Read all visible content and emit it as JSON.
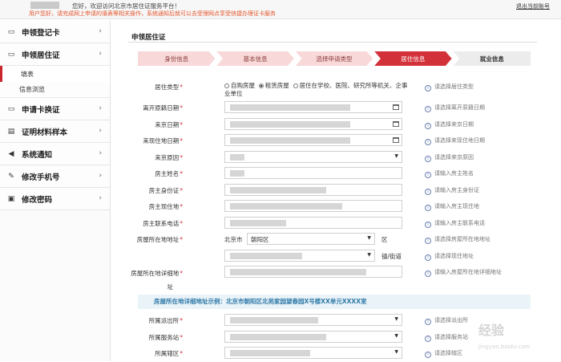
{
  "topbar": {
    "greeting": "您好，欢迎访问北京市居住证服务平台！",
    "notice": "用户您好，请完成网上申请的填表等相关操作，系统通知后就可以去受理网点享受快捷办理证卡服务",
    "logout": "退出当前账号"
  },
  "sidebar": {
    "items": [
      {
        "label": "申领登记卡",
        "icon": "id-card-icon"
      },
      {
        "label": "申领居住证",
        "icon": "id-card-icon"
      },
      {
        "label": "申请卡换证",
        "icon": "id-card-icon"
      },
      {
        "label": "证明材料样本",
        "icon": "document-icon"
      },
      {
        "label": "系统通知",
        "icon": "speaker-icon"
      },
      {
        "label": "修改手机号",
        "icon": "edit-icon"
      },
      {
        "label": "修改密码",
        "icon": "lock-icon"
      }
    ],
    "sub_fill": "填表",
    "sub_info": "信息浏览"
  },
  "main": {
    "title": "申领居住证",
    "steps": [
      "身份信息",
      "基本信息",
      "选择申请类型",
      "居住信息",
      "就业信息"
    ],
    "active_step": 3
  },
  "form": {
    "residence_type": {
      "label": "居住类型",
      "options": [
        "自购房屋",
        "租赁房屋",
        "居住在学校、医院、研究所等机关、企事业单位"
      ],
      "selected": 1,
      "hint": "请选择居住类型"
    },
    "leave_origin_date": {
      "label": "离开原籍日期",
      "hint": "请选择离开原籍日期"
    },
    "arrive_beijing_date": {
      "label": "来京日期",
      "hint": "请选择来京日期"
    },
    "arrive_current_date": {
      "label": "来现住地日期",
      "hint": "请选择来现住地日期"
    },
    "reason": {
      "label": "来京原因",
      "hint": "请选择来京原因"
    },
    "landlord_name": {
      "label": "房主姓名",
      "hint": "请输入房主姓名"
    },
    "landlord_id": {
      "label": "房主身份证",
      "hint": "请输入房主身份证"
    },
    "landlord_address": {
      "label": "房主现住地",
      "hint": "请输入房主现住地"
    },
    "landlord_phone": {
      "label": "房主联系电话",
      "hint": "请输入房主联系电话"
    },
    "house_location": {
      "label": "房屋所在地地址",
      "city": "北京市",
      "district": "朝阳区",
      "district_suffix": "区",
      "hint": "请选择房屋所在地地址"
    },
    "town": {
      "suffix": "镇/街道",
      "hint": "请选择现住地址"
    },
    "house_detail": {
      "label_line1": "房屋所在地详细地",
      "label_line2": "址",
      "hint": "请输入房屋所在地详细地址"
    },
    "example": "房屋所在地详细地址示例：北京市朝阳区北苑家园望春园X号楼XX单元XXXX室",
    "police_station": {
      "label": "所属派出所",
      "hint": "请选择派出所"
    },
    "service_station": {
      "label": "所属服务站",
      "hint": "请选择服务站"
    },
    "community": {
      "label": "所属辖区",
      "hint": "请选择辖区"
    }
  },
  "watermark": {
    "line1": "经验",
    "line2": "jingyan.baidu.com"
  }
}
